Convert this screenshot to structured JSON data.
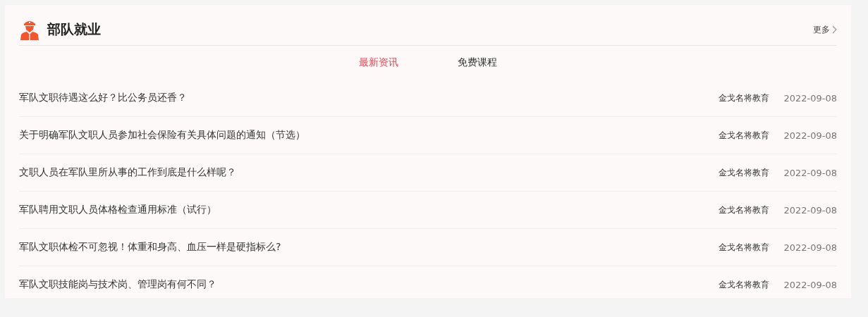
{
  "section": {
    "title": "部队就业",
    "more": "更多"
  },
  "tabs": [
    {
      "label": "最新资讯",
      "selected": true
    },
    {
      "label": "免费课程",
      "selected": false
    }
  ],
  "articles": [
    {
      "title": "军队文职待遇这么好？比公务员还香？",
      "source": "金戈名将教育",
      "date": "2022-09-08"
    },
    {
      "title": "关于明确军队文职人员参加社会保险有关具体问题的通知（节选）",
      "source": "金戈名将教育",
      "date": "2022-09-08"
    },
    {
      "title": "文职人员在军队里所从事的工作到底是什么样呢？",
      "source": "金戈名将教育",
      "date": "2022-09-08"
    },
    {
      "title": "军队聘用文职人员体格检查通用标准（试行）",
      "source": "金戈名将教育",
      "date": "2022-09-08"
    },
    {
      "title": "军队文职体检不可忽视！体重和身高、血压一样是硬指标么?",
      "source": "金戈名将教育",
      "date": "2022-09-08"
    },
    {
      "title": "军队文职技能岗与技术岗、管理岗有何不同？",
      "source": "金戈名将教育",
      "date": "2022-09-08"
    }
  ]
}
